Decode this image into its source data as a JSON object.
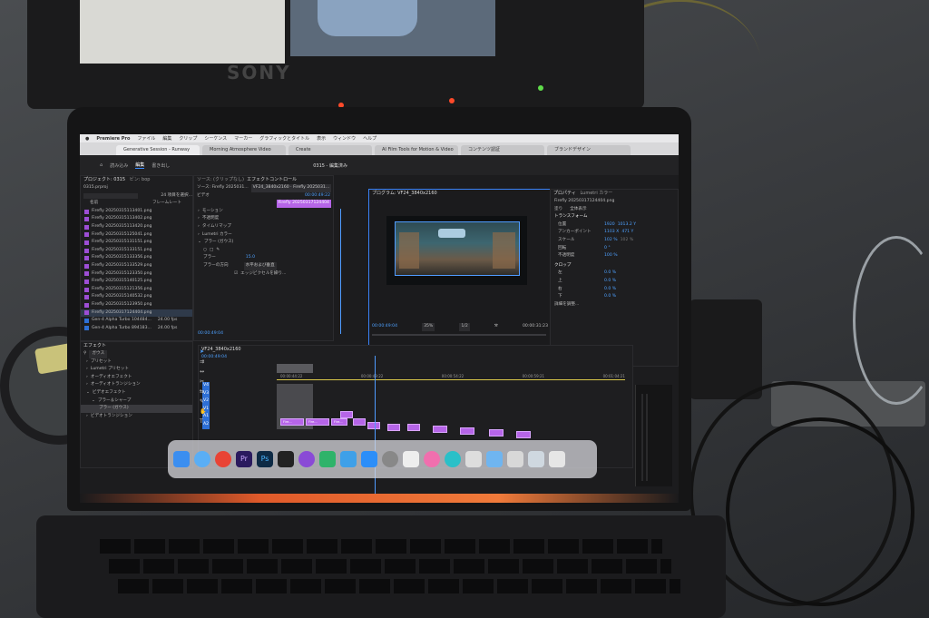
{
  "monitor": {
    "brand": "SONY"
  },
  "menubar": {
    "items": [
      "Premiere Pro",
      "ファイル",
      "編集",
      "クリップ",
      "シーケンス",
      "マーカー",
      "グラフィックとタイトル",
      "表示",
      "ウィンドウ",
      "ヘルプ"
    ]
  },
  "browser_tabs": [
    "Generative Session - Runway",
    "Morning Atmosphere Video",
    "Create",
    "AI Film Tools for Motion & Video",
    "コンテンツ認証",
    "ブランドデザイン"
  ],
  "app_header": {
    "items": [
      "読み込み",
      "編集",
      "書き出し"
    ],
    "selected": "編集",
    "center_title": "0315 - 編集済み"
  },
  "project_panel": {
    "title": "プロジェクト: 0315",
    "tab2": "ビン: bop",
    "subtitle": "0315.prproj",
    "count_label": "24 項目を選択...",
    "col_name": "名前",
    "col_rate": "フレームレート",
    "items": [
      "Firefly 20250315113401.png",
      "Firefly 20250315113402.png",
      "Firefly 20250315113420.png",
      "Firefly 20250315125041.png",
      "Firefly 20250315131151.png",
      "Firefly 20250315133151.png",
      "Firefly 20250315133356.png",
      "Firefly 20250315133529.png",
      "Firefly 20250315123350.png",
      "Firefly 20250315140125.png",
      "Firefly 20250315121356.png",
      "Firefly 20250315140532.png",
      "Firefly 20250315123950.png",
      "Firefly 20250317124404.png"
    ],
    "video_items": [
      {
        "name": "Gen-4 Alpha Turbo 104484...",
        "rate": "24.00 fps"
      },
      {
        "name": "Gen-4 Alpha Turbo 894183...",
        "rate": "24.00 fps"
      }
    ]
  },
  "effects_panel": {
    "title": "エフェクト",
    "search_value": "ガウス",
    "tree": [
      "プリセット",
      "Lumetri プリセット",
      "オーディオエフェクト",
      "オーディオトランジション",
      "ビデオエフェクト",
      "ブラー＆シャープ",
      "ブラー (ガウス)",
      "ビデオトランジション"
    ]
  },
  "effect_controls": {
    "tab_source": "ソース: (クリップなし)",
    "tab_effect": "エフェクトコントロール",
    "source_label": "ソース: Firefly 2025031...",
    "sequence_label": "VF24_3840x2160 · Firefly 2025031...",
    "clip_label": "Firefly 20250317124404",
    "timecode": "00:00:49:22",
    "section": "ビデオ",
    "rows": [
      "モーション",
      "不透明度",
      "タイムリマップ",
      "Lumetri カラー",
      "ブラー (ガウス)",
      "ブラー",
      "ブラーの方向",
      "エッジピクセルを繰り..."
    ],
    "blur_value": "15.0",
    "direction_value": "水平および垂直",
    "bottom_timecode": "00:00:49:04"
  },
  "program_monitor": {
    "title": "プログラム: VF24_3840x2160",
    "timecode": "00:00:49:04",
    "zoom": "35%",
    "quality": "1/2",
    "duration": "00:00:31:23"
  },
  "properties_panel": {
    "tab1": "プロパティ",
    "tab2": "Lumetri カラー",
    "file": "Firefly 20250317124404.png",
    "actions": [
      "塗り",
      "全体表示"
    ],
    "transform_title": "トランスフォーム",
    "rows": [
      {
        "label": "位置",
        "v1": "1920",
        "v2": "1013.2 Y"
      },
      {
        "label": "アンカーポイント",
        "v1": "1103 X",
        "v2": "471 Y"
      },
      {
        "label": "スケール",
        "v1": "102 %",
        "v2": "102 %"
      },
      {
        "label": "回転",
        "v1": "0 °",
        "v2": ""
      },
      {
        "label": "不透明度",
        "v1": "100 %",
        "v2": ""
      }
    ],
    "crop_title": "クロップ",
    "crop_rows": [
      {
        "label": "左",
        "v": "0.0 %"
      },
      {
        "label": "上",
        "v": "0.0 %"
      },
      {
        "label": "右",
        "v": "0.0 %"
      },
      {
        "label": "下",
        "v": "0.0 %"
      }
    ],
    "footer": "詳細を調整..."
  },
  "timeline": {
    "title": "VF24_3840x2160",
    "timecode": "00:00:49:04",
    "ruler": [
      "00:00:44:22",
      "00:00:49:22",
      "00:00:54:22",
      "00:00:59:21",
      "00:01:04:21"
    ],
    "tracks": [
      "V4",
      "V3",
      "V2",
      "V1",
      "A1",
      "A2"
    ],
    "clip_labels": [
      "Fire...",
      "Fire...",
      "Fire..."
    ]
  }
}
